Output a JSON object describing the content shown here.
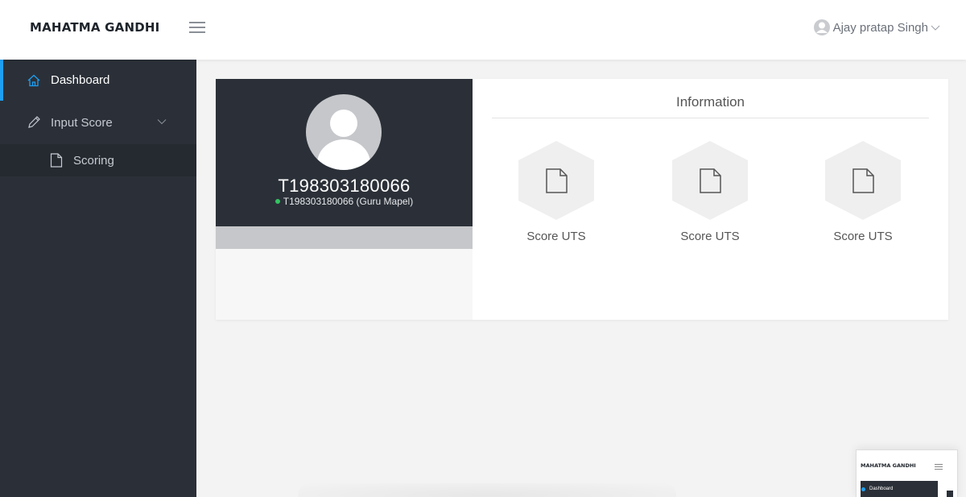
{
  "header": {
    "brand": "MAHATMA GANDHI",
    "menu_icon": "hamburger-icon",
    "user_name": "Ajay pratap Singh",
    "user_icon": "user-avatar-icon",
    "caret_icon": "chevron-down-icon"
  },
  "sidebar": {
    "items": [
      {
        "label": "Dashboard",
        "icon": "home-icon",
        "active": true
      },
      {
        "label": "Input Score",
        "icon": "pencil-icon",
        "expandable": true
      }
    ],
    "sub_items": [
      {
        "label": "Scoring",
        "icon": "file-icon"
      }
    ]
  },
  "profile": {
    "id": "T198303180066",
    "status_text": "T198303180066 (Guru Mapel)",
    "status_color": "#33c462"
  },
  "information": {
    "title": "Information",
    "tiles": [
      {
        "label": "Score UTS",
        "icon": "file-icon"
      },
      {
        "label": "Score UTS",
        "icon": "file-icon"
      },
      {
        "label": "Score UTS",
        "icon": "file-icon"
      }
    ]
  },
  "thumbnail": {
    "brand": "MAHATMA GANDHI",
    "item": "Dashboard"
  },
  "colors": {
    "accent": "#1e9ff2",
    "sidebar": "#2b3038",
    "sidebar_sub": "#252a31",
    "online": "#33c462"
  }
}
